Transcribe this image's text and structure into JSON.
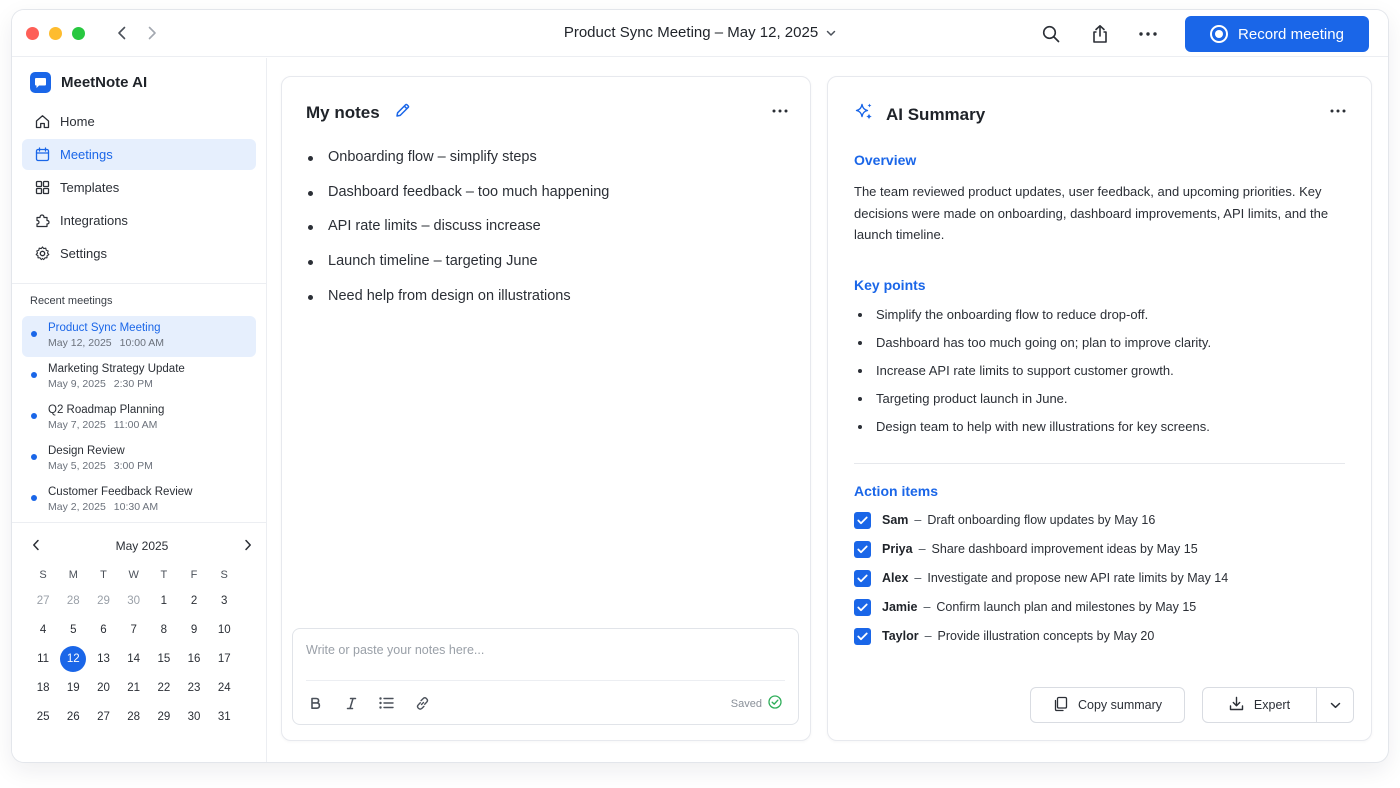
{
  "app": {
    "name": "MeetNote AI"
  },
  "titlebar": {
    "title": "Product Sync Meeting – May 12, 2025",
    "record_label": "Record meeting",
    "icons": [
      "chevron-left-icon",
      "chevron-right-icon",
      "search-icon",
      "share-icon",
      "more-icon"
    ]
  },
  "sidebar": {
    "nav": [
      {
        "label": "Home",
        "icon": "home-icon",
        "active": false
      },
      {
        "label": "Meetings",
        "icon": "calendar-icon",
        "active": true
      },
      {
        "label": "Templates",
        "icon": "grid-icon",
        "active": false
      },
      {
        "label": "Integrations",
        "icon": "puzzle-icon",
        "active": false
      },
      {
        "label": "Settings",
        "icon": "gear-icon",
        "active": false
      }
    ],
    "recent_title": "Recent meetings",
    "recent": [
      {
        "name": "Product Sync Meeting",
        "date": "May 12, 2025",
        "time": "10:00 AM",
        "active": true
      },
      {
        "name": "Marketing Strategy Update",
        "date": "May 9, 2025",
        "time": "2:30 PM",
        "active": false
      },
      {
        "name": "Q2 Roadmap Planning",
        "date": "May 7, 2025",
        "time": "11:00 AM",
        "active": false
      },
      {
        "name": "Design Review",
        "date": "May 5, 2025",
        "time": "3:00 PM",
        "active": false
      },
      {
        "name": "Customer Feedback Review",
        "date": "May 2, 2025",
        "time": "10:30 AM",
        "active": false
      }
    ],
    "calendar": {
      "month": "May 2025",
      "dow": [
        "S",
        "M",
        "T",
        "W",
        "T",
        "F",
        "S"
      ],
      "weeks": [
        [
          "27",
          "28",
          "29",
          "30",
          "1",
          "2",
          "3"
        ],
        [
          "4",
          "5",
          "6",
          "7",
          "8",
          "9",
          "10"
        ],
        [
          "11",
          "12",
          "13",
          "14",
          "15",
          "16",
          "17"
        ],
        [
          "18",
          "19",
          "20",
          "21",
          "22",
          "23",
          "24"
        ],
        [
          "25",
          "26",
          "27",
          "28",
          "29",
          "30",
          "31"
        ]
      ],
      "selected": "12"
    }
  },
  "notes": {
    "title": "My notes",
    "items": [
      "Onboarding flow – simplify steps",
      "Dashboard feedback – too much happening",
      "API rate limits – discuss increase",
      "Launch timeline – targeting June",
      "Need help from design on illustrations"
    ],
    "editor": {
      "placeholder": "Write or paste your notes here...",
      "value": "",
      "saved_label": "Saved",
      "tools": [
        "bold-icon",
        "italic-icon",
        "list-icon",
        "link-icon"
      ]
    }
  },
  "summary": {
    "title": "AI Summary",
    "overview_title": "Overview",
    "overview_text": "The team reviewed product updates, user feedback, and upcoming priorities. Key decisions were made on onboarding, dashboard improvements, API limits, and the launch timeline.",
    "key_points_title": "Key points",
    "key_points": [
      "Simplify the onboarding flow to reduce drop-off.",
      "Dashboard has too much going on; plan to improve clarity.",
      "Increase API rate limits to support customer growth.",
      "Targeting product launch in June.",
      "Design team to help with new illustrations for key screens."
    ],
    "action_items_title": "Action items",
    "action_items": [
      {
        "who": "Sam",
        "task": "Draft onboarding flow updates by May 16",
        "checked": true
      },
      {
        "who": "Priya",
        "task": "Share dashboard improvement ideas by May 15",
        "checked": true
      },
      {
        "who": "Alex",
        "task": "Investigate and propose new API rate limits by May 14",
        "checked": true
      },
      {
        "who": "Jamie",
        "task": "Confirm launch plan and milestones by May 15",
        "checked": true
      },
      {
        "who": "Taylor",
        "task": "Provide illustration concepts by May 20",
        "checked": true
      }
    ],
    "copy_label": "Copy summary",
    "export_label": "Expert"
  },
  "colors": {
    "accent": "#1a66e8",
    "active_bg": "#e6effd",
    "text": "#1f2329"
  }
}
